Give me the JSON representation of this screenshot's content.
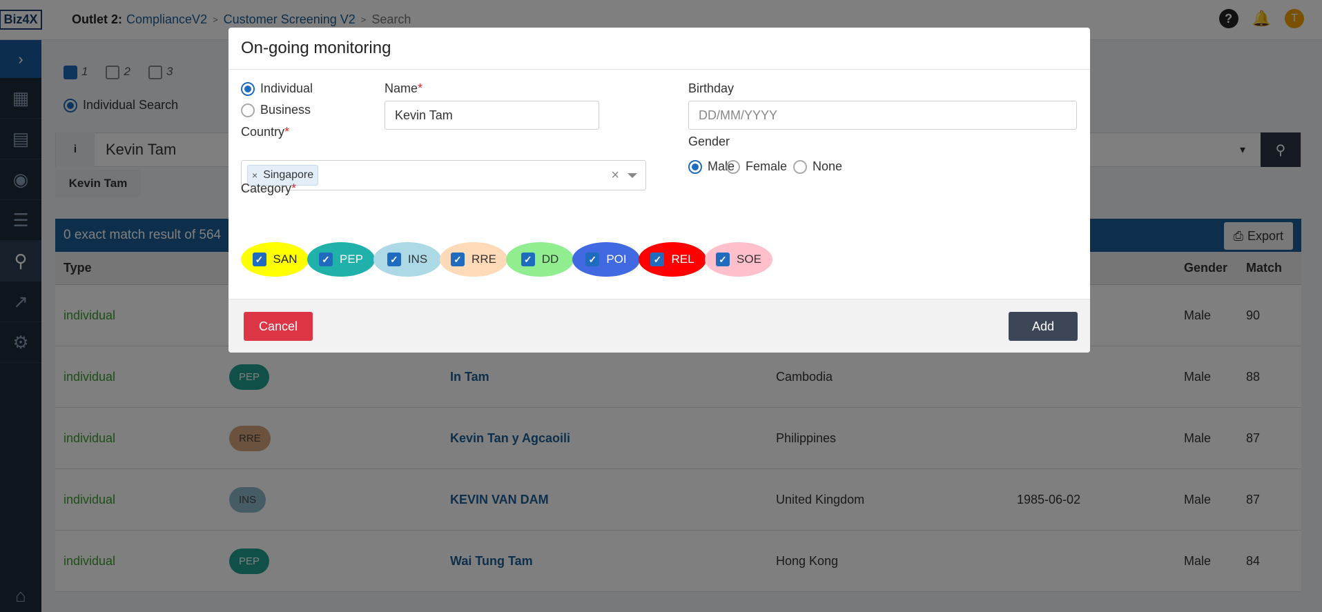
{
  "header": {
    "logo": "Biz4X",
    "outlet_label": "Outlet 2:",
    "outlet_name": "ComplianceV2",
    "crumb2": "Customer Screening V2",
    "crumb3": "Search",
    "user_initial": "T"
  },
  "sidebar": {
    "toggle_icon": "chevron-right-icon"
  },
  "background": {
    "flags": [
      "1",
      "2",
      "3"
    ],
    "search_type": "Individual Search",
    "search_value": "Kevin Tam",
    "tab": "Kevin Tam",
    "result_text": "0 exact match result of 564",
    "export_label": "Export",
    "columns": {
      "type": "Type",
      "gender": "Gender",
      "match": "Match"
    },
    "rows": [
      {
        "type": "individual",
        "cat": "",
        "name": "",
        "country": "",
        "dob": "",
        "gender": "Male",
        "match": "90",
        "color": ""
      },
      {
        "type": "individual",
        "cat": "PEP",
        "name": "In Tam",
        "country": "Cambodia",
        "dob": "",
        "gender": "Male",
        "match": "88",
        "color": "#20a090"
      },
      {
        "type": "individual",
        "cat": "RRE",
        "name": "Kevin Tan y Agcaoili",
        "country": "Philippines",
        "dob": "",
        "gender": "Male",
        "match": "87",
        "color": "#d4a47f"
      },
      {
        "type": "individual",
        "cat": "INS",
        "name": "KEVIN VAN DAM",
        "country": "United Kingdom",
        "dob": "1985-06-02",
        "gender": "Male",
        "match": "87",
        "color": "#8cb8c9"
      },
      {
        "type": "individual",
        "cat": "PEP",
        "name": "Wai Tung Tam",
        "country": "Hong Kong",
        "dob": "",
        "gender": "Male",
        "match": "84",
        "color": "#20a090"
      }
    ]
  },
  "modal": {
    "title": "On-going monitoring",
    "type_individual": "Individual",
    "type_business": "Business",
    "name_label": "Name",
    "name_value": "Kevin Tam",
    "birthday_label": "Birthday",
    "birthday_placeholder": "DD/MM/YYYY",
    "country_label": "Country",
    "country_value": "Singapore",
    "gender_label": "Gender",
    "gender_male": "Male",
    "gender_female": "Female",
    "gender_none": "None",
    "category_label": "Category",
    "categories": [
      {
        "label": "SAN",
        "color": "#ffff00",
        "text": "#222"
      },
      {
        "label": "PEP",
        "color": "#20b2aa",
        "text": "#fff"
      },
      {
        "label": "INS",
        "color": "#add8e6",
        "text": "#333"
      },
      {
        "label": "RRE",
        "color": "#ffdab9",
        "text": "#333"
      },
      {
        "label": "DD",
        "color": "#90ee90",
        "text": "#333"
      },
      {
        "label": "POI",
        "color": "#4169e1",
        "text": "#fff"
      },
      {
        "label": "REL",
        "color": "#ff0000",
        "text": "#fff"
      },
      {
        "label": "SOE",
        "color": "#ffc0cb",
        "text": "#333"
      }
    ],
    "cancel_label": "Cancel",
    "add_label": "Add"
  }
}
